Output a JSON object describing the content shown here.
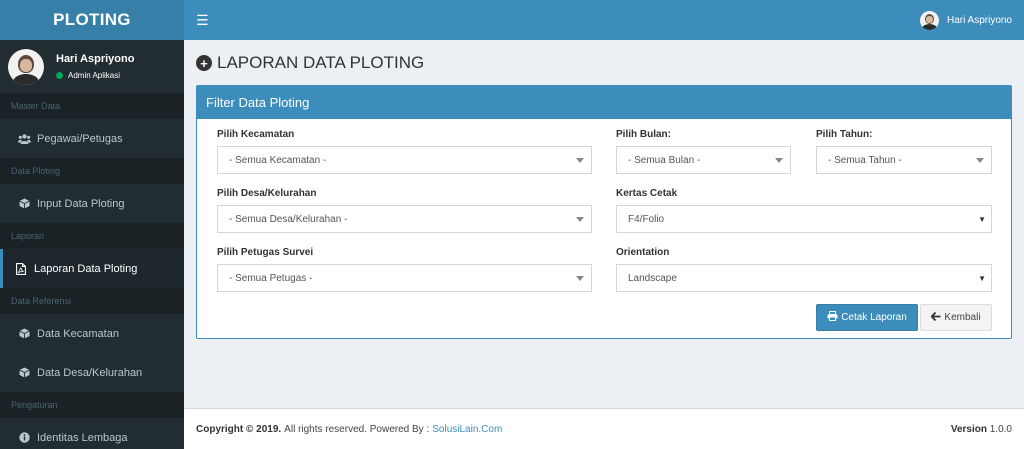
{
  "app": {
    "logo": "PLOTING"
  },
  "user": {
    "name": "Hari Aspriyono",
    "role": "Admin Aplikasi"
  },
  "sidebar": {
    "sections": [
      {
        "header": "Master Data",
        "items": [
          {
            "label": "Pegawai/Petugas",
            "icon": "users-icon"
          }
        ]
      },
      {
        "header": "Data Ploting",
        "items": [
          {
            "label": "Input Data Ploting",
            "icon": "cube-icon"
          }
        ]
      },
      {
        "header": "Laporan",
        "items": [
          {
            "label": "Laporan Data Ploting",
            "icon": "pdf-file-icon",
            "active": true
          }
        ]
      },
      {
        "header": "Data Referensi",
        "items": [
          {
            "label": "Data Kecamatan",
            "icon": "cube-icon"
          },
          {
            "label": "Data Desa/Kelurahan",
            "icon": "cube-icon"
          }
        ]
      },
      {
        "header": "Pengaturan",
        "items": [
          {
            "label": "Identitas Lembaga",
            "icon": "info-circle-icon"
          }
        ]
      }
    ]
  },
  "topnav": {
    "menu_icon": "hamburger-icon",
    "user_name": "Hari Aspriyono"
  },
  "page": {
    "title": "LAPORAN DATA PLOTING"
  },
  "filter": {
    "title": "Filter Data Ploting",
    "kecamatan": {
      "label": "Pilih Kecamatan",
      "value": "- Semua Kecamatan -"
    },
    "bulan": {
      "label": "Pilih Bulan:",
      "value": "- Semua Bulan -"
    },
    "tahun": {
      "label": "Pilih Tahun:",
      "value": "- Semua Tahun -"
    },
    "desa": {
      "label": "Pilih Desa/Kelurahan",
      "value": "- Semua Desa/Kelurahan -"
    },
    "kertas": {
      "label": "Kertas Cetak",
      "value": "F4/Folio"
    },
    "petugas": {
      "label": "Pilih Petugas Survei",
      "value": "- Semua Petugas -"
    },
    "orientation": {
      "label": "Orientation",
      "value": "Landscape"
    },
    "print_button": "Cetak Laporan",
    "back_button": "Kembali"
  },
  "footer": {
    "copyright": "Copyright © 2019.",
    "rights": "All rights reserved. Powered By :",
    "powered_link": "SolusiLain.Com",
    "version_label": "Version",
    "version_value": "1.0.0"
  },
  "colors": {
    "primary": "#3c8dbc",
    "sidebar_bg": "#222d32",
    "logo_bg": "#367fa9",
    "online": "#00a65a"
  }
}
